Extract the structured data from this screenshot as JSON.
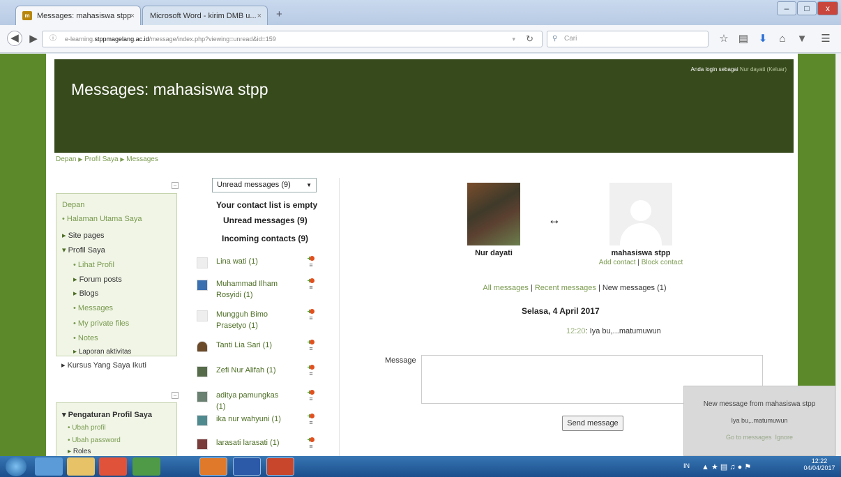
{
  "browser": {
    "tabs": [
      {
        "label": "Messages: mahasiswa stpp",
        "icon": "moodle-icon",
        "active": true
      },
      {
        "label": "Microsoft Word - kirim DMB u...",
        "icon": "document-icon",
        "active": false
      }
    ],
    "new_tab": "+",
    "close": "×",
    "url_prefix": "e-learning.",
    "url_domain": "stppmagelang.ac.id",
    "url_path": "/message/index.php?viewing=unread&id=159",
    "search_placeholder": "Cari",
    "window_buttons": [
      "–",
      "□",
      "x"
    ]
  },
  "header": {
    "title": "Messages: mahasiswa stpp",
    "login_text": "Anda login sebagai",
    "login_user": "Nur dayati",
    "logout": "(Keluar)"
  },
  "breadcrumb": {
    "items": [
      "Depan",
      "Profil Saya",
      "Messages"
    ],
    "sep": "▶"
  },
  "nav_block": {
    "collapse": "−",
    "root": "Depan",
    "items": [
      {
        "label": "Halaman Utama Saya"
      },
      {
        "label": "Site pages"
      },
      {
        "label": "Profil Saya"
      },
      {
        "label": "Lihat Profil"
      },
      {
        "label": "Forum posts"
      },
      {
        "label": "Blogs"
      },
      {
        "label": "Messages"
      },
      {
        "label": "My private files"
      },
      {
        "label": "Notes"
      },
      {
        "label": "Laporan aktivitas"
      },
      {
        "label": "Kursus Yang Saya Ikuti"
      }
    ]
  },
  "settings_block": {
    "collapse": "−",
    "title": "Pengaturan Profil Saya",
    "items": [
      {
        "label": "Ubah profil"
      },
      {
        "label": "Ubah password"
      },
      {
        "label": "Roles"
      }
    ]
  },
  "contacts": {
    "select_value": "Unread messages (9)",
    "empty_text": "Your contact list is empty",
    "unread_heading": "Unread messages (9)",
    "incoming_heading": "Incoming contacts (9)",
    "list": [
      {
        "name": "Lina wati (1)"
      },
      {
        "name": "Muhammad Ilham Rosyidi (1)"
      },
      {
        "name": "Mungguh Bimo Prasetyo (1)"
      },
      {
        "name": "Tanti Lia Sari (1)"
      },
      {
        "name": "Zefi Nur Alifah (1)"
      },
      {
        "name": "aditya pamungkas (1)"
      },
      {
        "name": "ika nur wahyuni (1)"
      },
      {
        "name": "larasati larasati (1)"
      }
    ]
  },
  "conversation": {
    "me_name": "Nur dayati",
    "arrow": "↔",
    "other_name": "mahasiswa stpp",
    "add_contact": "Add contact",
    "block_contact": "Block contact",
    "sep": "|",
    "filter_all": "All messages",
    "filter_recent": "Recent messages",
    "filter_new": "New messages (1)",
    "date": "Selasa, 4 April 2017",
    "msg_time": "12:20",
    "msg_text": ": Iya bu,...matumuwun",
    "message_label": "Message",
    "send_button": "Send message"
  },
  "notification": {
    "title": "New message from mahasiswa stpp",
    "text": "Iya bu,..matumuwun",
    "go": "Go to messages",
    "ignore": "Ignore"
  },
  "taskbar": {
    "lang": "IN",
    "time": "12:22",
    "date": "04/04/2017"
  }
}
